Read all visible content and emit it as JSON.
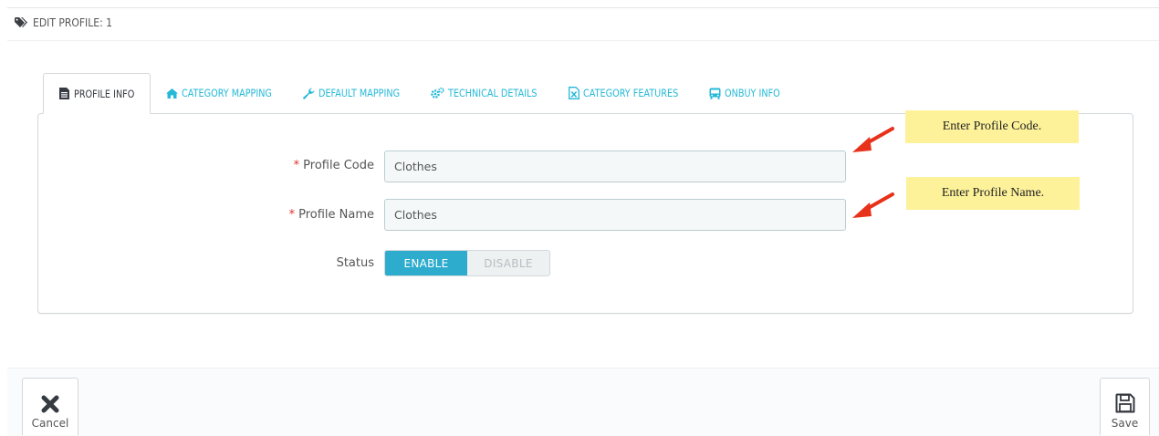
{
  "header": {
    "title": "EDIT PROFILE: 1",
    "icon": "tags-icon"
  },
  "tabs": [
    {
      "label": "PROFILE INFO",
      "icon": "file-text-icon",
      "active": true
    },
    {
      "label": "CATEGORY MAPPING",
      "icon": "home-icon",
      "active": false
    },
    {
      "label": "DEFAULT MAPPING",
      "icon": "wrench-icon",
      "active": false
    },
    {
      "label": "TECHNICAL DETAILS",
      "icon": "cogs-icon",
      "active": false
    },
    {
      "label": "CATEGORY FEATURES",
      "icon": "file-excel-icon",
      "active": false
    },
    {
      "label": "ONBUY INFO",
      "icon": "bus-icon",
      "active": false
    }
  ],
  "form": {
    "required_mark": "*",
    "profile_code": {
      "label": "Profile Code",
      "value": "Clothes"
    },
    "profile_name": {
      "label": "Profile Name",
      "value": "Clothes"
    },
    "status": {
      "label": "Status",
      "enable_label": "ENABLE",
      "disable_label": "DISABLE",
      "selected": "ENABLE"
    }
  },
  "annotations": {
    "code_note": "Enter Profile Code.",
    "name_note": "Enter Profile Name."
  },
  "footer": {
    "cancel_label": "Cancel",
    "save_label": "Save"
  },
  "colors": {
    "accent": "#25b9d7",
    "switch_on": "#2eacce",
    "required": "#e0312d",
    "callout": "#fdf29a",
    "arrow": "#e8311a"
  }
}
